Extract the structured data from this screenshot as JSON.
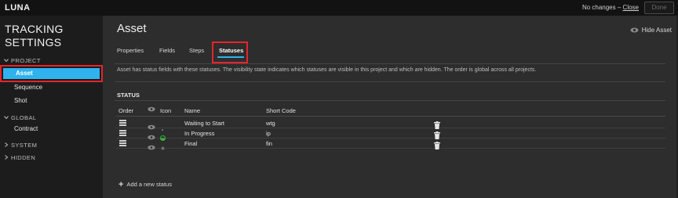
{
  "app": {
    "logo": "LUNA"
  },
  "topbar": {
    "status_text": "No changes –",
    "close_link": "Close",
    "done_label": "Done"
  },
  "sidebar": {
    "title_line1": "TRACKING",
    "title_line2": "SETTINGS",
    "sections": [
      {
        "label": "PROJECT",
        "expanded": true,
        "items": [
          "Asset",
          "Sequence",
          "Shot"
        ]
      },
      {
        "label": "GLOBAL",
        "expanded": true,
        "items": [
          "Contract"
        ]
      },
      {
        "label": "SYSTEM",
        "expanded": false,
        "items": []
      },
      {
        "label": "HIDDEN",
        "expanded": false,
        "items": []
      }
    ],
    "selected_item": "Asset",
    "chevron_down": "⌄",
    "chevron_right": "›"
  },
  "main": {
    "title": "Asset",
    "hide_label": "Hide Asset",
    "tabs": [
      "Properties",
      "Fields",
      "Steps",
      "Statuses"
    ],
    "active_tab": "Statuses",
    "description": "Asset has status fields with these statuses. The visibility state indicates which statuses are visible in this project and which are hidden. The order is global across all projects.",
    "status_heading": "STATUS",
    "columns": {
      "order": "Order",
      "icon": "Icon",
      "name": "Name",
      "short_code": "Short Code"
    },
    "rows": [
      {
        "icon": "dot-icon",
        "name": "Waiting to Start",
        "short_code": "wtg"
      },
      {
        "icon": "in-progress-icon",
        "name": "In Progress",
        "short_code": "ip"
      },
      {
        "icon": "final-icon",
        "name": "Final",
        "short_code": "fin"
      }
    ],
    "add_label": "Add a new status"
  },
  "colors": {
    "accent": "#2fb2ee",
    "highlight": "#e8232b",
    "in_progress": "#3cb43c"
  }
}
